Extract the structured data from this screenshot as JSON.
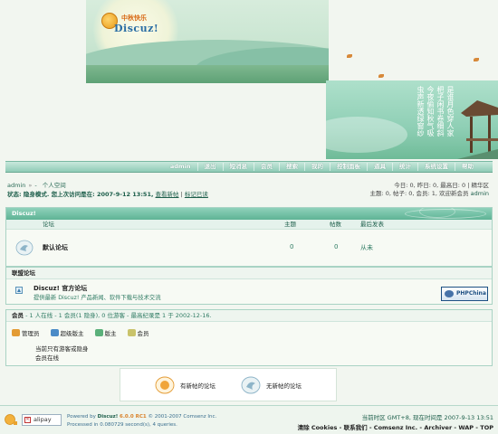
{
  "logo": {
    "cn": "中秋快乐",
    "text": "Discuz!"
  },
  "poem": [
    "是谁月色穿人家",
    "杷子闲书卷细斜",
    "今夜偷知秋气吸",
    "虫声新透绿窗纱"
  ],
  "nav": [
    "admin",
    "退出",
    "短消息",
    "会员",
    "搜索",
    "我的",
    "控制面板",
    "道具",
    "统计",
    "系统设置",
    "帮助"
  ],
  "crumb": {
    "user": "admin",
    "sep": "»",
    "space": "个人空间"
  },
  "status": {
    "prefix": "状态: 隐身模式. 您上次访问是在: 2007-9-12 13:51,",
    "new_posts": "查看新帖",
    "mark": "标记已读"
  },
  "right_info": {
    "line1": "今日: 0, 昨日: 0, 最高日: 0 | 精华区",
    "line2_prefix": "主题: 0, 帖子: 0, 会员: 1, 欢迎新会员",
    "new_member": "admin"
  },
  "forum_category": {
    "title": "Discuz!",
    "columns": {
      "forum": "论坛",
      "threads": "主题",
      "posts": "帖数",
      "lastpost": "最后发表"
    },
    "forums": [
      {
        "name": "默认论坛",
        "threads": "0",
        "posts": "0",
        "lastpost": "从未"
      }
    ]
  },
  "league": {
    "title": "联盟论坛",
    "items": [
      {
        "name": "Discuz! 官方论坛",
        "desc": "提供最新 Discuz! 产品新闻、软件下载与技术交流",
        "banner": "PHPChina"
      }
    ]
  },
  "online": {
    "title": "会员",
    "summary": " - 1 人在线 - 1 会员(1 隐身), 0 位游客 - 最高纪录是 1 于 2002-12-16.",
    "groups": [
      {
        "label": "管理员",
        "color": "#e39b34"
      },
      {
        "label": "超级版主",
        "color": "#4b8bc7"
      },
      {
        "label": "版主",
        "color": "#5bb07a"
      },
      {
        "label": "会员",
        "color": "#c9c36a"
      }
    ],
    "line1": "当前只有游客或隐身",
    "line2": "会员在线"
  },
  "legend": {
    "new": "有新帖的论坛",
    "none": "无新帖的论坛"
  },
  "footer": {
    "alipay": "alipay",
    "powered_prefix": "Powered by",
    "product": "Discuz!",
    "version": "6.0.0 RC1",
    "copyright": "© 2001-2007 Comsenz Inc.",
    "processed": "Processed in 0.080729 second(s), 4 queries.",
    "time": "当前时区  GMT+8, 现在时间是  2007-9-13 13:51",
    "links": "清除  Cookies - 联系我们 - Comsenz Inc. - Archiver - WAP - TOP"
  },
  "colors": {
    "accent": "#5eb395",
    "link": "#1c5e4a",
    "nav": "#8fcbb6"
  }
}
